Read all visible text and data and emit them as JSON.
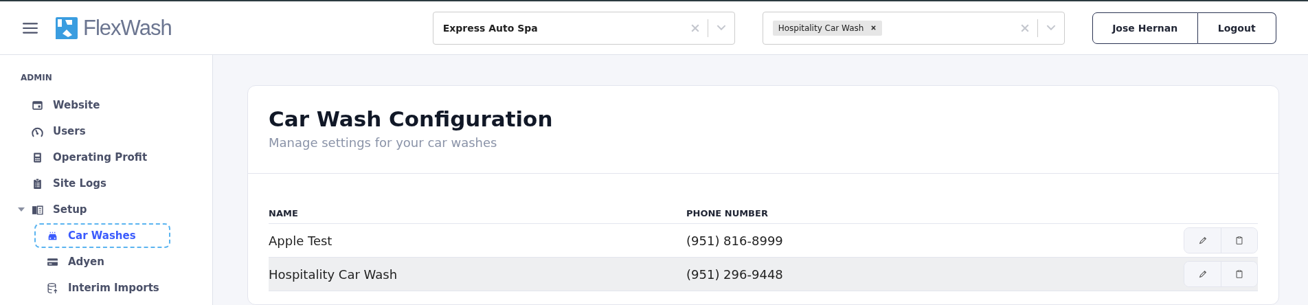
{
  "header": {
    "brand": "FlexWash",
    "site_select": {
      "value": "Express Auto Spa"
    },
    "wash_select": {
      "tags": [
        "Hospitality Car Wash"
      ]
    },
    "user_button": "Jose Hernan",
    "logout_button": "Logout"
  },
  "sidebar": {
    "section": "ADMIN",
    "items": [
      {
        "label": "Website",
        "kind": "window",
        "selected": false
      },
      {
        "label": "Users",
        "kind": "gauge",
        "selected": false
      },
      {
        "label": "Operating Profit",
        "kind": "calculator",
        "selected": false
      },
      {
        "label": "Site Logs",
        "kind": "clipboard",
        "selected": false
      },
      {
        "label": "Setup",
        "kind": "book",
        "selected": false,
        "expanded": true,
        "children": [
          {
            "label": "Car Washes",
            "kind": "car",
            "selected": true
          },
          {
            "label": "Adyen",
            "kind": "card",
            "selected": false
          },
          {
            "label": "Interim Imports",
            "kind": "database",
            "selected": false
          }
        ]
      }
    ]
  },
  "card": {
    "title": "Car Wash Configuration",
    "subtitle": "Manage settings for your car washes",
    "table": {
      "columns": [
        "NAME",
        "PHONE NUMBER"
      ],
      "rows": [
        {
          "name": "Apple Test",
          "phone": "(951) 816-8999",
          "hovered": false
        },
        {
          "name": "Hospitality Car Wash",
          "phone": "(951) 296-9448",
          "hovered": true
        }
      ]
    }
  }
}
